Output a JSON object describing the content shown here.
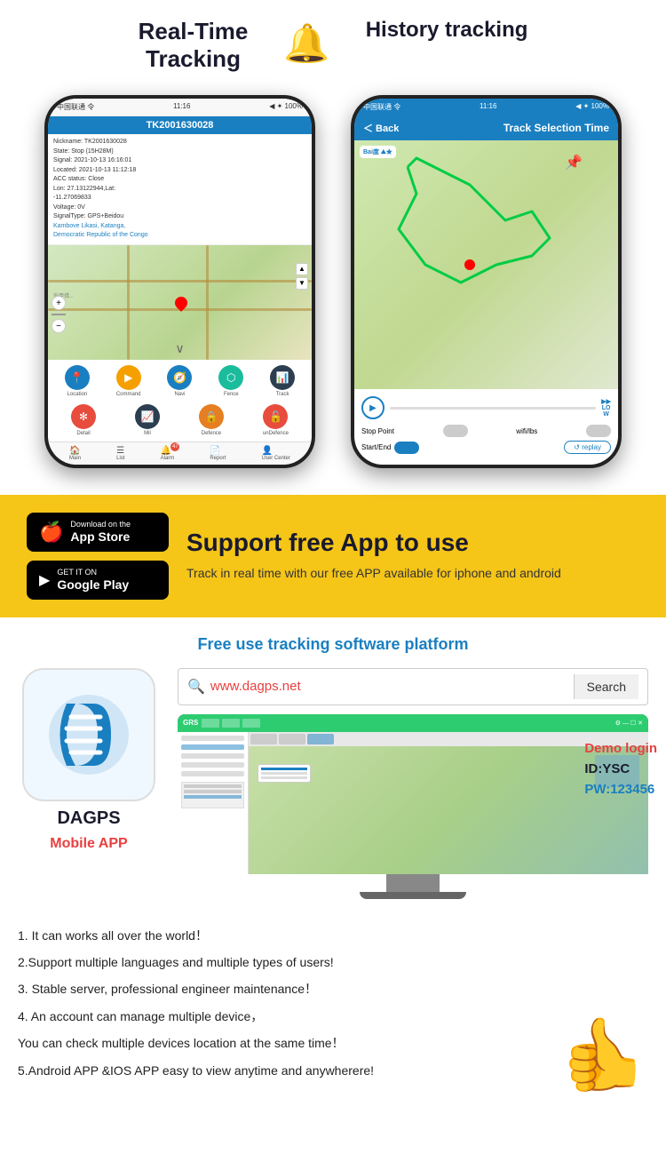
{
  "header": {
    "real_time_tracking": "Real-Time\nTracking",
    "history_tracking": "History tracking",
    "bell": "🔔"
  },
  "phone1": {
    "status_bar": "中国联通 令",
    "time": "11:16",
    "signal": "◀ ✦ 100%",
    "header_title": "TK2001630028",
    "info_nickname": "Nickname: TK2001630028",
    "info_state": "State: Stop (15H28M)",
    "info_signal": "Signal: 2021-10-13 16:16:01",
    "info_located": "Located: 2021-10-13 11:12:18",
    "info_acc": "ACC status: Close",
    "info_coords": "Lon: 27.13122944,Lat:",
    "info_coords2": "-11.27069833",
    "info_voltage": "Voltage: 0V",
    "info_signal_type": "SignalType: GPS+Beidou",
    "info_location": "Kambove Likasi, Katanga,\nDemocratic Republic of the Congo",
    "toolbar": {
      "location": "Location",
      "command": "Command",
      "navi": "Navi",
      "fence": "Fence",
      "track": "Track",
      "detail": "Detail",
      "mil": "Mil",
      "defence": "Defence",
      "undefence": "unDefence"
    },
    "bottom": {
      "main": "Main",
      "list": "List",
      "alarm": "Alarm",
      "report": "Report",
      "user": "User Center"
    }
  },
  "phone2": {
    "status_bar": "中国联通 令",
    "time": "11:16",
    "signal": "◀ ✦ 100%",
    "back": "< Back",
    "header_title": "Track Selection Time",
    "stop_point": "Stop Point",
    "wifi_lbs": "wifi/lbs",
    "start_end": "Start/End",
    "replay": "↺ replay",
    "speed": "LO\nW"
  },
  "yellow_section": {
    "app_store_small": "Download on the",
    "app_store_large": "App Store",
    "google_small": "GET IT ON",
    "google_large": "Google Play",
    "support_title": "Support free App to use",
    "support_desc": "Track in real time with our free APP available for iphone and android"
  },
  "platform": {
    "title": "Free use tracking software platform",
    "dagps_name": "DAGPS",
    "mobile_app": "Mobile APP",
    "search_url": "www.dagps.net",
    "search_btn": "Search",
    "demo_login": "Demo login",
    "demo_id": "ID:YSC",
    "demo_pw": "PW:123456"
  },
  "features": {
    "item1": "1. It can works all over the world！",
    "item2": "2.Support multiple languages and multiple types of users!",
    "item3": "3. Stable server, professional engineer maintenance！",
    "item4": "4. An account can manage multiple device，",
    "item4b": "You can check multiple devices location at the same time！",
    "item5": "5.Android APP &IOS APP easy to view anytime and anywherere!"
  }
}
